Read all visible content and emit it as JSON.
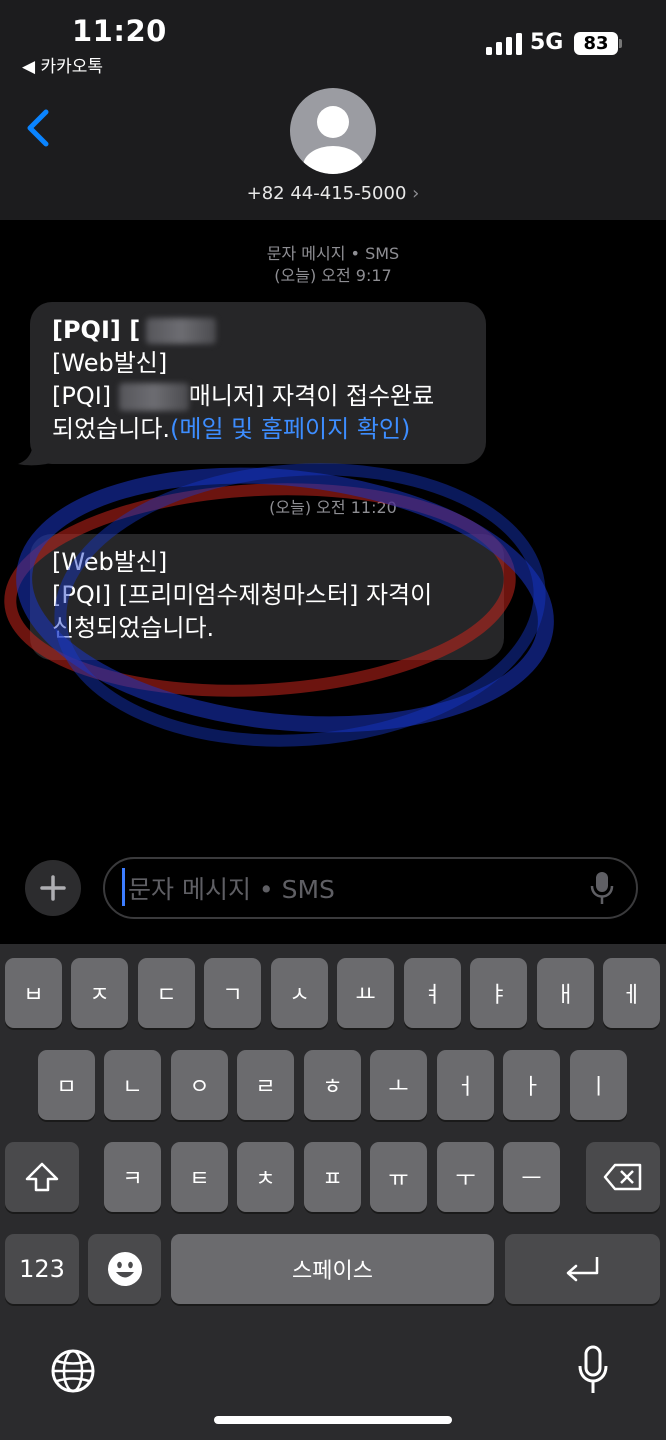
{
  "status": {
    "time": "11:20",
    "back_app": "◀ 카카오톡",
    "network": "5G",
    "battery": "83"
  },
  "header": {
    "phone": "+82 44-415-5000",
    "arrow": "›"
  },
  "thread": {
    "meta1_line1": "문자 메시지 • SMS",
    "meta1_line2": "(오늘) 오전 9:17",
    "meta2": "(오늘) 오전 11:20",
    "msg1": {
      "line1": "[PQI] [",
      "line2": "[Web발신]",
      "line3a": "[PQI] ",
      "line3b": "매니저] 자격이 접수완료",
      "line4a": "되었습니다.",
      "line4b": "(메일 및 홈페이지 확인)"
    },
    "msg2": {
      "line1": "[Web발신]",
      "line2": "[PQI] [프리미엄수제청마스터] 자격이",
      "line3": "신청되었습니다."
    }
  },
  "compose": {
    "placeholder": "문자 메시지 • SMS",
    "plus": "+"
  },
  "keyboard": {
    "row1": [
      "ㅂ",
      "ㅈ",
      "ㄷ",
      "ㄱ",
      "ㅅ",
      "ㅛ",
      "ㅕ",
      "ㅑ",
      "ㅐ",
      "ㅔ"
    ],
    "row2": [
      "ㅁ",
      "ㄴ",
      "ㅇ",
      "ㄹ",
      "ㅎ",
      "ㅗ",
      "ㅓ",
      "ㅏ",
      "ㅣ"
    ],
    "row3": [
      "ㅋ",
      "ㅌ",
      "ㅊ",
      "ㅍ",
      "ㅠ",
      "ㅜ",
      "ㅡ"
    ],
    "numbers": "123",
    "space": "스페이스"
  },
  "colors": {
    "accent": "#0a84ff",
    "bubble": "#262628",
    "key": "#6b6b6e",
    "key_dark": "#4a4a4c"
  }
}
